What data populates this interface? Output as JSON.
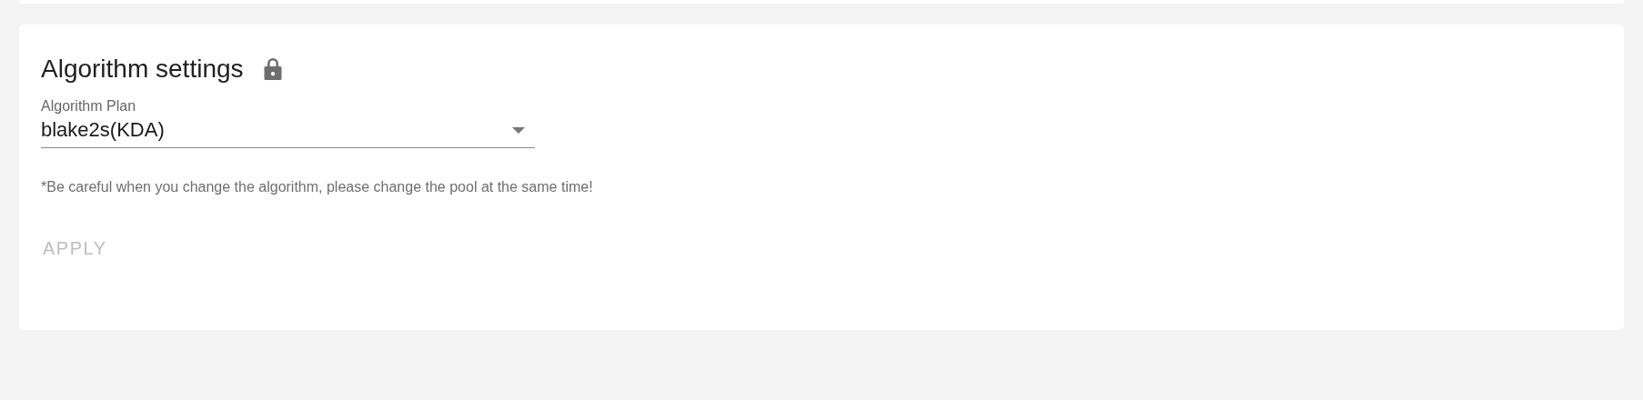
{
  "title": "Algorithm settings",
  "locked": true,
  "field": {
    "label": "Algorithm Plan",
    "value": "blake2s(KDA)"
  },
  "note": "*Be careful when you change the algorithm, please change the pool at the same time!",
  "apply_button": {
    "label": "APPLY",
    "disabled": true
  }
}
